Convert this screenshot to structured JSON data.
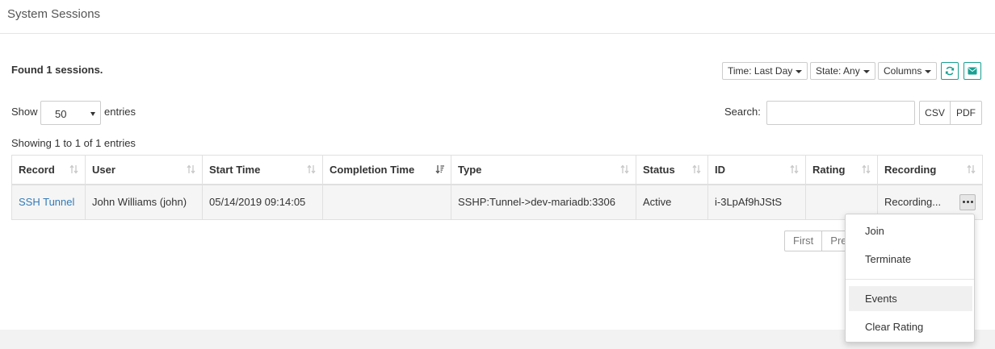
{
  "header": {
    "title": "System Sessions"
  },
  "summary": {
    "found": "Found 1 sessions."
  },
  "filters": {
    "time": "Time: Last Day",
    "state": "State: Any",
    "columns": "Columns"
  },
  "toolbar_icons": {
    "refresh": "refresh-icon",
    "email": "envelope-icon",
    "accent": "#1aa093"
  },
  "length": {
    "show": "Show",
    "value": "50",
    "entries": "entries"
  },
  "search": {
    "label": "Search:",
    "value": ""
  },
  "export": {
    "csv": "CSV",
    "pdf": "PDF"
  },
  "info": "Showing 1 to 1 of 1 entries",
  "table": {
    "columns": [
      "Record",
      "User",
      "Start Time",
      "Completion Time",
      "Type",
      "Status",
      "ID",
      "Rating",
      "Recording"
    ],
    "rows": [
      {
        "record": "SSH Tunnel",
        "user": "John Williams (john)",
        "start_time": "05/14/2019 09:14:05",
        "completion_time": "",
        "type": "SSHP:Tunnel->dev-mariadb:3306",
        "status": "Active",
        "id": "i-3LpAf9hJStS",
        "rating": "",
        "recording": "Recording..."
      }
    ]
  },
  "pagination": {
    "first": "First",
    "previous": "Pre"
  },
  "menu": {
    "items": [
      "Join",
      "Terminate",
      "Events",
      "Clear Rating"
    ],
    "highlighted": "Events"
  },
  "colors": {
    "link": "#337ab7",
    "border": "#e0e0e0",
    "row_bg": "#f5f5f5"
  }
}
